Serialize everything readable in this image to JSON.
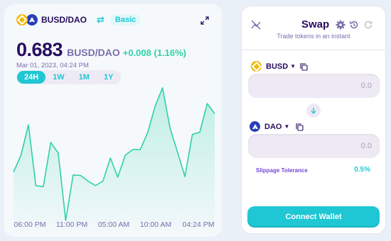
{
  "chart_panel": {
    "pair_label": "BUSD/DAO",
    "mode_badge": "Basic",
    "price": "0.683",
    "price_pair": "BUSD/DAO",
    "price_change": "+0.008 (1.16%)",
    "date": "Mar 01, 2023, 04:24 PM",
    "range_tabs": [
      "24H",
      "1W",
      "1M",
      "1Y"
    ],
    "active_range": "24H",
    "accent_color": "#1fc7d4",
    "line_color": "#31d0aa"
  },
  "chart_data": {
    "type": "area",
    "title": "",
    "xlabel": "",
    "ylabel": "",
    "x_ticks": [
      "06:00 PM",
      "11:00 PM",
      "05:00 AM",
      "10:00 AM",
      "04:24 PM"
    ],
    "series": [
      {
        "values": [
          0.6745,
          0.6775,
          0.6829,
          0.6721,
          0.6719,
          0.6798,
          0.6779,
          0.6659,
          0.674,
          0.6739,
          0.6729,
          0.6721,
          0.6729,
          0.677,
          0.6736,
          0.6775,
          0.6785,
          0.6785,
          0.6815,
          0.6862,
          0.6895,
          0.6824,
          0.6781,
          0.6737,
          0.6812,
          0.6816,
          0.6867,
          0.6849
        ]
      }
    ],
    "ylim": [
      0.664,
      0.6905
    ],
    "grid": false,
    "legend": "none"
  },
  "swap_panel": {
    "title": "Swap",
    "subtitle": "Trade tokens in an instant",
    "from_token": "BUSD",
    "to_token": "DAO",
    "from_amount_placeholder": "0.0",
    "to_amount_placeholder": "0.0",
    "slippage_label": "Slippage Tolerance",
    "slippage_value": "0.5%",
    "connect_label": "Connect Wallet"
  }
}
